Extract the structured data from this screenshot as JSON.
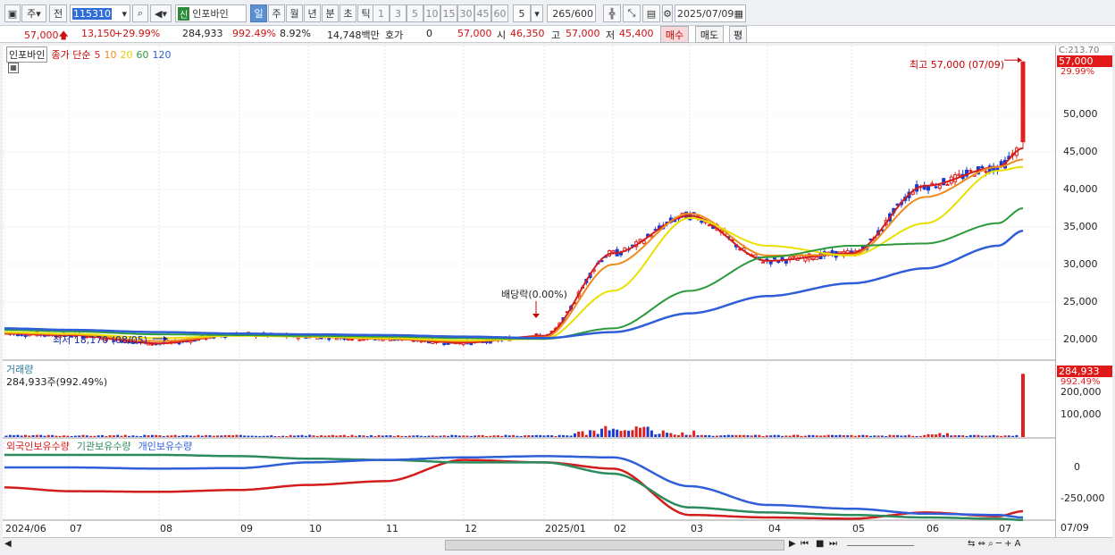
{
  "toolbar": {
    "period_label": "주",
    "prev_label": "전",
    "stock_code": "115310",
    "stock_tag": "신",
    "stock_name": "인포바인",
    "intervals": [
      "일",
      "주",
      "월",
      "년",
      "분",
      "초",
      "틱"
    ],
    "minute_steps": [
      "1",
      "3",
      "5",
      "10",
      "15",
      "30",
      "45",
      "60"
    ],
    "step_value": "5",
    "count_value": "265",
    "count_max": "/600",
    "date_value": "2025/07/09"
  },
  "info": {
    "price": "57,000",
    "change": "13,150",
    "change_pct": "+29.99%",
    "volume": "284,933",
    "volume_pct": "992.49%",
    "turnover_pct": "8.92%",
    "amount": "14,748백만",
    "hoga_label": "호가",
    "hoga_value": "0",
    "hoga_price": "57,000",
    "open_label": "시",
    "open_value": "46,350",
    "high_label": "고",
    "high_value": "57,000",
    "low_label": "저",
    "low_value": "45,400",
    "buy_label": "매수",
    "sell_label": "매도",
    "eval_label": "평"
  },
  "price_panel": {
    "legend_name": "인포바인",
    "legend_ma": "종가 단순",
    "ma_periods": [
      "5",
      "10",
      "20",
      "60",
      "120"
    ],
    "ma_colors": [
      "#d41c1c",
      "#f08a1c",
      "#e8e000",
      "#2c9a3c",
      "#2f5fd8"
    ],
    "high_note": "최고 57,000 (07/09)",
    "low_note": "최저 18,170 (08/05)",
    "dividend_note": "배당락(0.00%)",
    "price_tag": "57,000",
    "pct_tag": "29.99%",
    "cap_tag": "C:213.70"
  },
  "volume_panel": {
    "title": "거래량",
    "value": "284,933주(992.49%)",
    "tag_value": "284,933",
    "tag_pct": "992.49%"
  },
  "holding_panel": {
    "legends": [
      "외국인보유수량",
      "기관보유수량",
      "개인보유수량"
    ],
    "colors": [
      "#d41c1c",
      "#2c8a5c",
      "#2f5fd8"
    ]
  },
  "x_axis_labels": [
    "2024/06",
    "07",
    "08",
    "09",
    "10",
    "11",
    "12",
    "2025/01",
    "02",
    "03",
    "04",
    "05",
    "06",
    "07",
    "07/09"
  ],
  "price_axis": [
    "50,000",
    "45,000",
    "40,000",
    "35,000",
    "30,000",
    "25,000",
    "20,000"
  ],
  "volume_axis": [
    "200,000",
    "100,000"
  ],
  "holding_axis": [
    "0",
    "-250,000"
  ],
  "chart_data": {
    "type": "line",
    "title": "인포바인",
    "series": [
      {
        "name": "5",
        "x": [
          "2024/06",
          "07",
          "08",
          "09",
          "10",
          "11",
          "12",
          "2025/01",
          "02",
          "03",
          "04",
          "05",
          "06",
          "07",
          "07/09"
        ],
        "values": [
          20800,
          20600,
          19500,
          20700,
          20400,
          20100,
          19600,
          20500,
          31500,
          36500,
          30500,
          31500,
          40500,
          43000,
          45500
        ]
      },
      {
        "name": "10",
        "x": [
          "2024/06",
          "07",
          "08",
          "09",
          "10",
          "11",
          "12",
          "2025/01",
          "02",
          "03",
          "04",
          "05",
          "06",
          "07",
          "07/09"
        ],
        "values": [
          20900,
          20700,
          19800,
          20600,
          20400,
          20100,
          19800,
          20300,
          30000,
          36800,
          31200,
          31300,
          39000,
          43000,
          44000
        ]
      },
      {
        "name": "20",
        "x": [
          "2024/06",
          "07",
          "08",
          "09",
          "10",
          "11",
          "12",
          "2025/01",
          "02",
          "03",
          "04",
          "05",
          "06",
          "07",
          "07/09"
        ],
        "values": [
          21000,
          20800,
          20200,
          20500,
          20400,
          20200,
          19900,
          20100,
          26500,
          36200,
          32500,
          31200,
          35500,
          42500,
          43000
        ]
      },
      {
        "name": "60",
        "x": [
          "2024/06",
          "07",
          "08",
          "09",
          "10",
          "11",
          "12",
          "2025/01",
          "02",
          "03",
          "04",
          "05",
          "06",
          "07",
          "07/09"
        ],
        "values": [
          21300,
          21100,
          20700,
          20600,
          20500,
          20400,
          20200,
          20100,
          21500,
          26500,
          31000,
          32500,
          32800,
          35500,
          37500
        ]
      },
      {
        "name": "120",
        "x": [
          "2024/06",
          "07",
          "08",
          "09",
          "10",
          "11",
          "12",
          "2025/01",
          "02",
          "03",
          "04",
          "05",
          "06",
          "07",
          "07/09"
        ],
        "values": [
          21500,
          21300,
          21000,
          20800,
          20700,
          20600,
          20400,
          20200,
          21000,
          23500,
          25800,
          27500,
          29500,
          32500,
          34500
        ]
      }
    ],
    "ylim": [
      17500,
      57500
    ],
    "high": {
      "x": "07/09",
      "value": 57000
    },
    "low": {
      "x": "08/05",
      "value": 18170
    },
    "volume_last": 284933,
    "volume_ylim": [
      0,
      290000
    ]
  }
}
